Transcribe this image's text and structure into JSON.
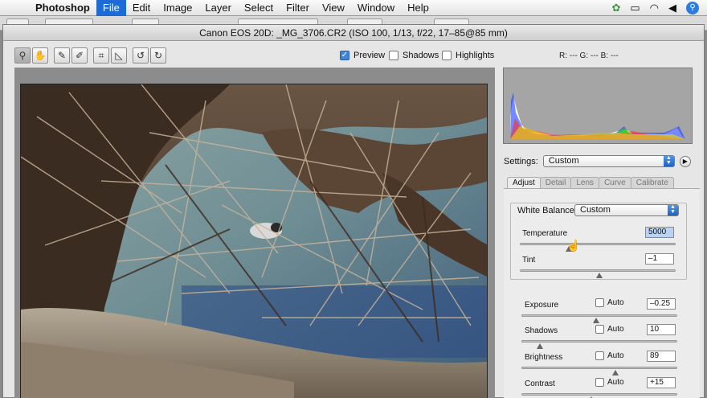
{
  "menubar": {
    "apple": "",
    "items": [
      "Photoshop",
      "File",
      "Edit",
      "Image",
      "Layer",
      "Select",
      "Filter",
      "View",
      "Window",
      "Help"
    ],
    "active_index": 1
  },
  "dialog": {
    "title": "Canon EOS 20D:  _MG_3706.CR2  (ISO 100, 1/13, f/22, 17–85@85 mm)"
  },
  "toolbar": {
    "tools": [
      "zoom-tool",
      "hand-tool",
      "white-balance-tool",
      "color-sampler-tool",
      "crop-tool",
      "straighten-tool",
      "rotate-left-tool",
      "rotate-right-tool"
    ],
    "preview_label": "Preview",
    "preview_checked": true,
    "shadows_label": "Shadows",
    "shadows_checked": false,
    "highlights_label": "Highlights",
    "highlights_checked": false,
    "rgb_readout": "R: ---   G: ---   B: ---"
  },
  "settings": {
    "label": "Settings:",
    "value": "Custom"
  },
  "tabs": [
    "Adjust",
    "Detail",
    "Lens",
    "Curve",
    "Calibrate"
  ],
  "adjust": {
    "white_balance_label": "White Balance:",
    "white_balance_value": "Custom",
    "temperature_label": "Temperature",
    "temperature_value": "5000",
    "tint_label": "Tint",
    "tint_value": "–1",
    "exposure_label": "Exposure",
    "exposure_value": "–0.25",
    "shadows_label": "Shadows",
    "shadows_value": "10",
    "brightness_label": "Brightness",
    "brightness_value": "89",
    "contrast_label": "Contrast",
    "contrast_value": "+15",
    "auto_label": "Auto"
  },
  "colors": {
    "menu_highlight": "#1e6bd8",
    "checkbox_blue": "#3f86dd"
  }
}
